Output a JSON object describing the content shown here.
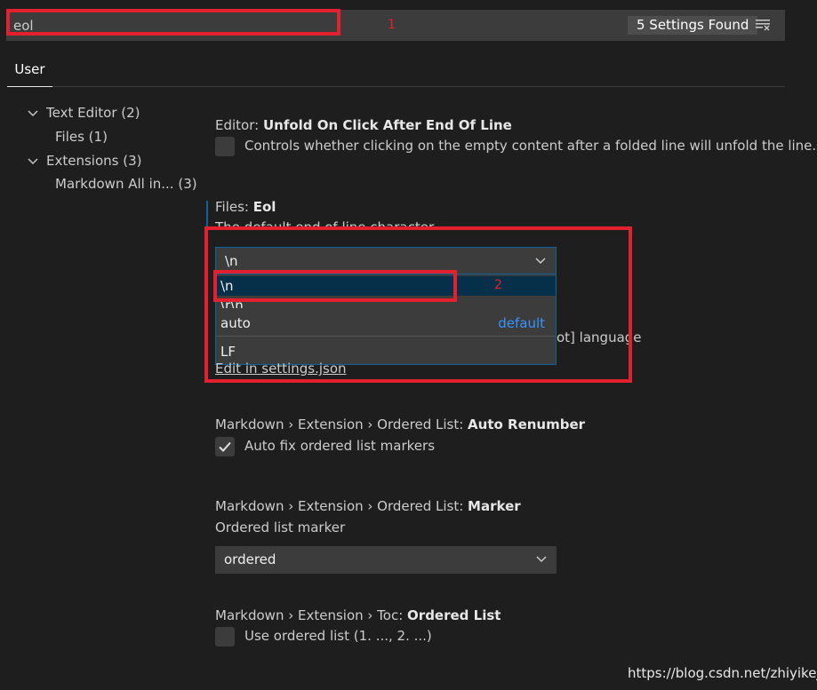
{
  "search": {
    "value": "eol",
    "results_count": "5 Settings Found"
  },
  "tabs": [
    {
      "label": "User"
    }
  ],
  "toc": [
    {
      "label": "Text Editor (2)"
    },
    {
      "label": "Files (1)"
    },
    {
      "label": "Extensions (3)"
    },
    {
      "label": "Markdown All in... (3)"
    }
  ],
  "settings": {
    "unfold": {
      "category": "Editor:",
      "name": "Unfold On Click After End Of Line",
      "description": "Controls whether clicking on the empty content after a folded line will unfold the line."
    },
    "eol": {
      "category": "Files:",
      "name": "Eol",
      "description": "The default end of line character.",
      "current_value": "\\n",
      "options": [
        {
          "label": "\\n"
        },
        {
          "label": "\\r\\n"
        },
        {
          "label": "auto",
          "tag": "default"
        }
      ],
      "extra_option": "LF",
      "behind_text": "ot] language",
      "edit_link": "Edit in settings.json"
    },
    "auto_renumber": {
      "category": "Markdown › Extension › Ordered List:",
      "name": "Auto Renumber",
      "description": "Auto fix ordered list markers",
      "checked": true
    },
    "marker": {
      "category": "Markdown › Extension › Ordered List:",
      "name": "Marker",
      "description": "Ordered list marker",
      "value": "ordered"
    },
    "toc_ordered": {
      "category": "Markdown › Extension › Toc:",
      "name": "Ordered List",
      "description": "Use ordered list (1. ..., 2. ...)",
      "checked": false
    }
  },
  "annotations": {
    "label_1": "1",
    "label_2": "2"
  },
  "watermark": "https://blog.csdn.net/zhiyikeji",
  "colors": {
    "background": "#1e1e1e",
    "input_background": "#3c3c3c",
    "accent_blue": "#3794ff",
    "annotation_red": "#e3202e"
  }
}
